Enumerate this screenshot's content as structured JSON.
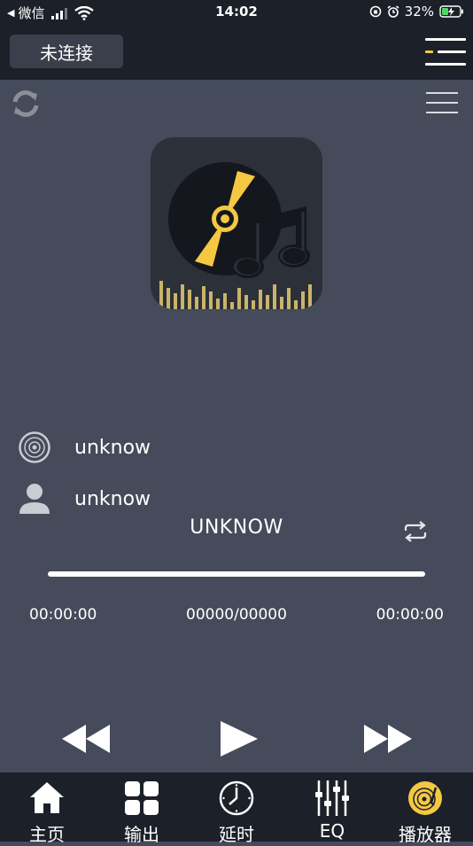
{
  "status_bar": {
    "back_app": "微信",
    "time": "14:02",
    "battery_percent": "32%"
  },
  "header": {
    "connect_button": "未连接"
  },
  "track": {
    "album": "unknow",
    "artist": "unknow",
    "title": "UNKNOW",
    "elapsed": "00:00:00",
    "counter": "00000/00000",
    "duration": "00:00:00",
    "progress": 0
  },
  "tabs": [
    {
      "label": "主页",
      "icon": "home-icon"
    },
    {
      "label": "输出",
      "icon": "grid-icon"
    },
    {
      "label": "延时",
      "icon": "clock-icon"
    },
    {
      "label": "EQ",
      "icon": "equalizer-icon"
    },
    {
      "label": "播放器",
      "icon": "turntable-icon"
    }
  ],
  "colors": {
    "background": "#454b5a",
    "bar": "#1c2029",
    "accent": "#f5c842"
  }
}
